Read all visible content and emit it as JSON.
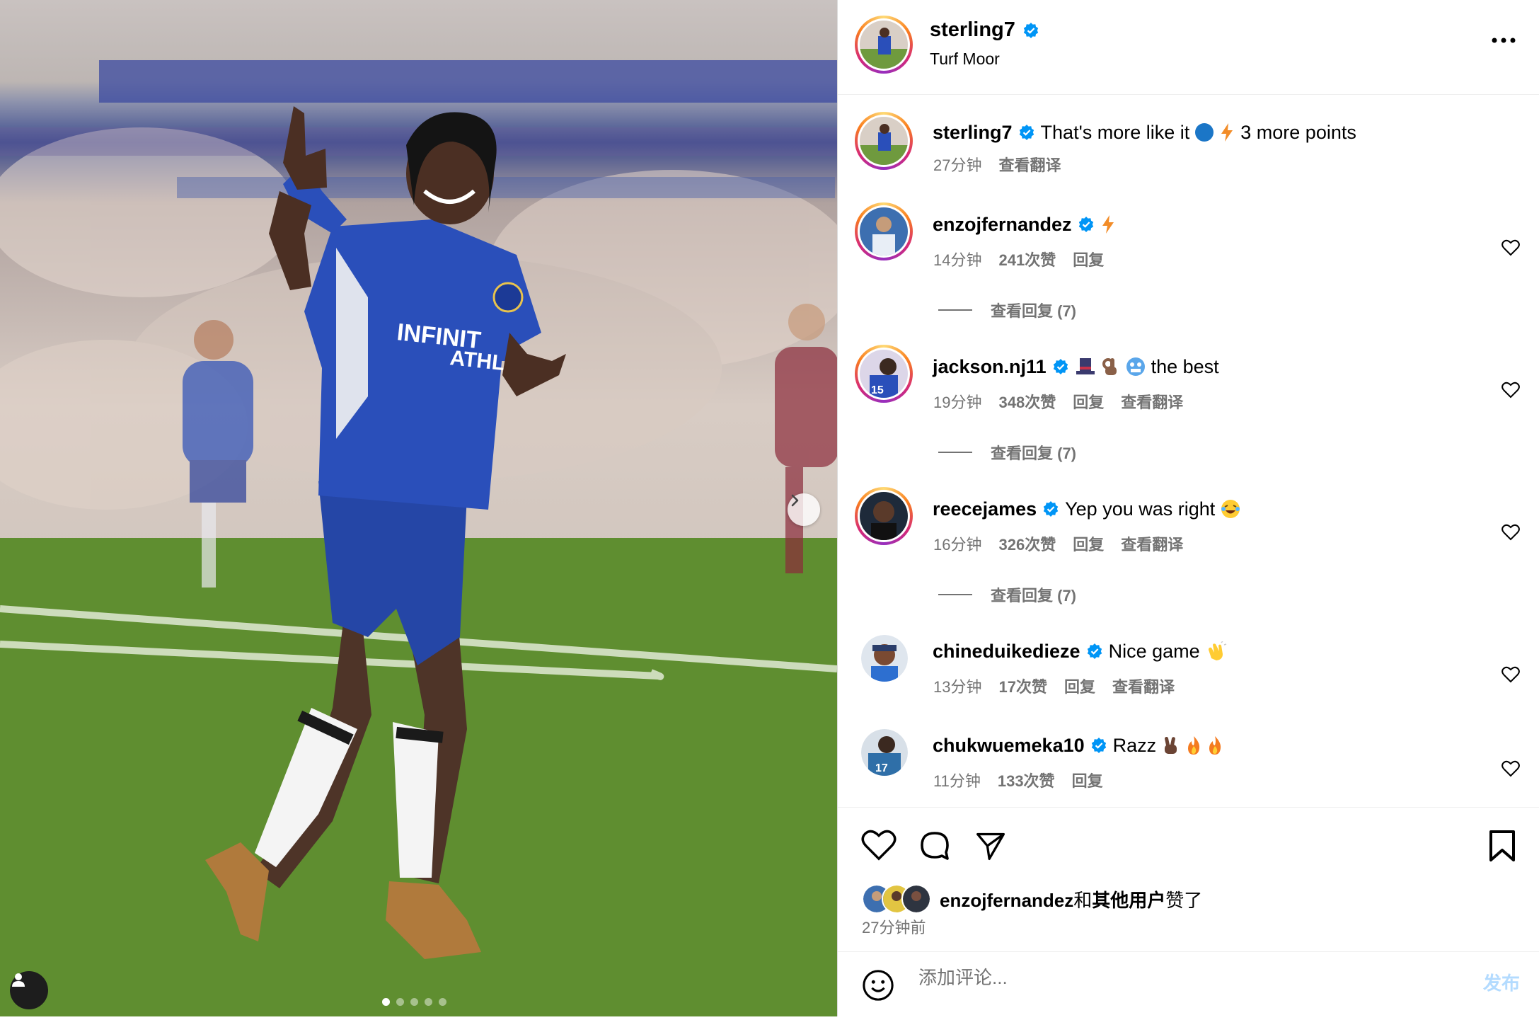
{
  "post": {
    "author": "sterling7",
    "location": "Turf Moor",
    "caption_body": "That's more like it",
    "caption_tail": "3 more points",
    "caption_time": "27分钟",
    "caption_translate": "查看翻译"
  },
  "comments": [
    {
      "user": "enzojfernandez",
      "text": "",
      "time": "14分钟",
      "likes": "241次赞",
      "reply": "回复",
      "translate": "",
      "view_replies": "查看回复 (7)"
    },
    {
      "user": "jackson.nj11",
      "text": "the best",
      "time": "19分钟",
      "likes": "348次赞",
      "reply": "回复",
      "translate": "查看翻译",
      "view_replies": "查看回复 (7)"
    },
    {
      "user": "reecejames",
      "text": "Yep you was right",
      "time": "16分钟",
      "likes": "326次赞",
      "reply": "回复",
      "translate": "查看翻译",
      "view_replies": "查看回复 (7)"
    },
    {
      "user": "chineduikedieze",
      "text": "Nice game",
      "time": "13分钟",
      "likes": "17次赞",
      "reply": "回复",
      "translate": "查看翻译",
      "view_replies": ""
    },
    {
      "user": "chukwuemeka10",
      "text": "Razz",
      "time": "11分钟",
      "likes": "133次赞",
      "reply": "回复",
      "translate": "",
      "view_replies": ""
    }
  ],
  "liked_by": {
    "user": "enzojfernandez",
    "connector": "和",
    "others": "其他用户",
    "suffix": "赞了",
    "time": "27分钟前"
  },
  "comment_box": {
    "placeholder": "添加评论...",
    "post_label": "发布"
  },
  "carousel": {
    "count": 5,
    "active": 1
  },
  "colors": {
    "verified": "#0095f6",
    "muted": "#737373",
    "post_disabled": "#b3dbff",
    "chelsea_blue": "#1f3fae"
  }
}
